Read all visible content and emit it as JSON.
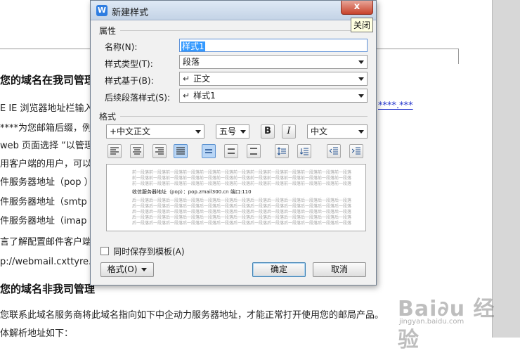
{
  "document": {
    "lines": [
      "您的域名在我司管理",
      "E IE 浏览器地址栏输入",
      "****为您邮箱后缀，例",
      "web 页面选择 “以管理",
      "用客户端的用户，可以",
      "件服务器地址（pop ）",
      "件服务器地址（smtp ）",
      "件服务器地址（imap ）",
      "言了解配置邮件客户端",
      "p://webmail.cxttyre.c",
      "您的域名非我司管理",
      "您联系此域名服务商将此域名指向如下中企动力服务器地址，才能正常打开使用您的邮局产品。",
      "体解析地址如下："
    ],
    "link_fragment": "****.***"
  },
  "watermark": {
    "brand": "Bai∂u 经验",
    "url": "jingyan.baidu.com"
  },
  "dialog": {
    "title": "新建样式",
    "close_symbol": "x",
    "close_tooltip": "关闭",
    "properties": {
      "section_label": "属性",
      "name_label": "名称(N):",
      "name_value": "样式1",
      "type_label": "样式类型(T):",
      "type_value": "段落",
      "based_on_label": "样式基于(B):",
      "based_on_value": "正文",
      "next_label": "后续段落样式(S):",
      "next_value": "样式1"
    },
    "format": {
      "section_label": "格式",
      "font": "+中文正文",
      "size": "五号",
      "bold": "B",
      "italic": "I",
      "language": "中文"
    },
    "preview": {
      "filler": "前一段落前一段落前一段落前一段落前一段落前一段落前一段落前一段落前一段落前一段落前一段落前一段落前一段落",
      "text": "收信服务器地址（pop）：pop.zmail300.cn    端口:110",
      "after": "后一段落后一段落后一段落后一段落后一段落后一段落后一段落后一段落后一段落后一段落后一段落后一段落后一段落"
    },
    "save_to_template": "同时保存到模板(A)",
    "format_button": "格式(O)",
    "ok_button": "确定",
    "cancel_button": "取消"
  },
  "colors": {
    "accent": "#3399ff",
    "close": "#c8432b",
    "titlebar": "#c4d3e6"
  }
}
